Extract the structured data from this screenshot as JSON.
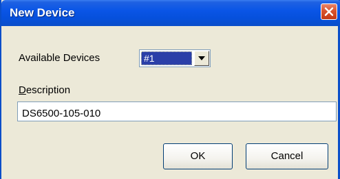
{
  "dialog": {
    "title": "New Device"
  },
  "form": {
    "available_devices_label": "Available Devices",
    "available_devices_value": "#1",
    "description_label": "Description",
    "description_value": "DS6500-105-010"
  },
  "buttons": {
    "ok_label": "OK",
    "cancel_label": "Cancel"
  },
  "icons": {
    "close": "close-icon",
    "dropdown": "chevron-down-icon"
  },
  "colors": {
    "titlebar": "#0a55e6",
    "close_button": "#d9532d",
    "dialog_background": "#ece9d8",
    "selection": "#2b3fa8"
  }
}
